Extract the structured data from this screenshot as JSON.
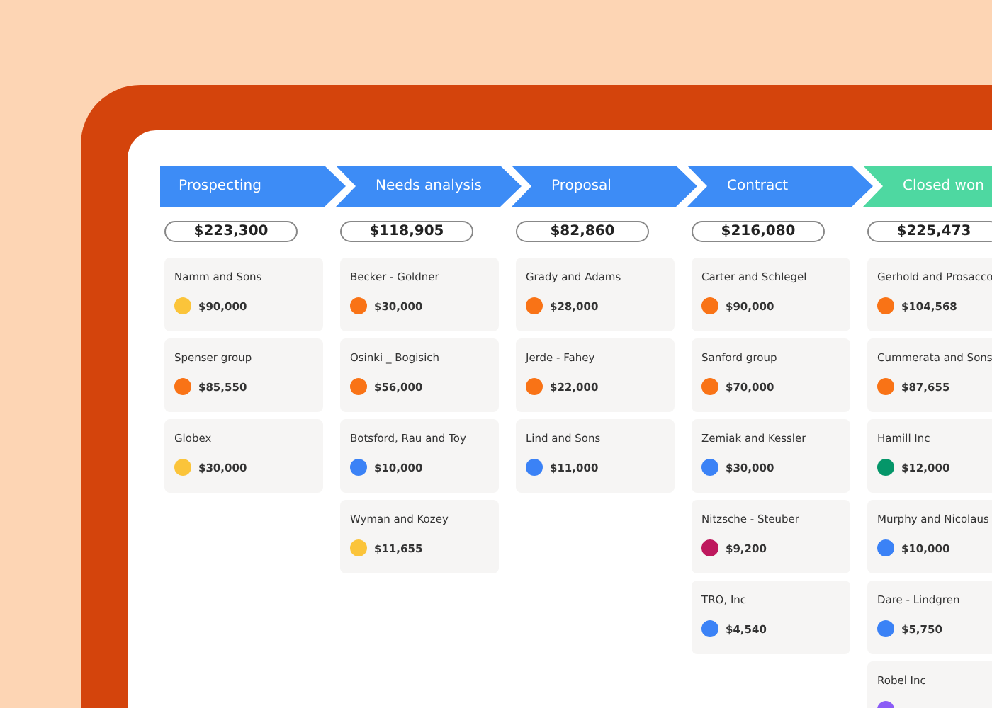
{
  "stages": [
    {
      "name": "Prospecting",
      "color": "#3d8cf6",
      "total": "$223,300",
      "deals": [
        {
          "company": "Namm and Sons",
          "amount": "$90,000",
          "color": "#fbc43a"
        },
        {
          "company": "Spenser group",
          "amount": "$85,550",
          "color": "#f97316"
        },
        {
          "company": "Globex",
          "amount": "$30,000",
          "color": "#fbc43a"
        }
      ]
    },
    {
      "name": "Needs analysis",
      "color": "#3d8cf6",
      "total": "$118,905",
      "deals": [
        {
          "company": "Becker - Goldner",
          "amount": "$30,000",
          "color": "#f97316"
        },
        {
          "company": "Osinki _ Bogisich",
          "amount": "$56,000",
          "color": "#f97316"
        },
        {
          "company": "Botsford, Rau and Toy",
          "amount": "$10,000",
          "color": "#3b82f6"
        },
        {
          "company": "Wyman and Kozey",
          "amount": "$11,655",
          "color": "#fbc43a"
        }
      ]
    },
    {
      "name": "Proposal",
      "color": "#3d8cf6",
      "total": "$82,860",
      "deals": [
        {
          "company": "Grady and Adams",
          "amount": "$28,000",
          "color": "#f97316"
        },
        {
          "company": "Jerde - Fahey",
          "amount": "$22,000",
          "color": "#f97316"
        },
        {
          "company": "Lind and Sons",
          "amount": "$11,000",
          "color": "#3b82f6"
        }
      ]
    },
    {
      "name": "Contract",
      "color": "#3d8cf6",
      "total": "$216,080",
      "deals": [
        {
          "company": "Carter and Schlegel",
          "amount": "$90,000",
          "color": "#f97316"
        },
        {
          "company": "Sanford group",
          "amount": "$70,000",
          "color": "#f97316"
        },
        {
          "company": "Zemiak and Kessler",
          "amount": "$30,000",
          "color": "#3b82f6"
        },
        {
          "company": "Nitzsche - Steuber",
          "amount": "$9,200",
          "color": "#be185d"
        },
        {
          "company": "TRO, Inc",
          "amount": "$4,540",
          "color": "#3b82f6"
        }
      ]
    },
    {
      "name": "Closed won",
      "color": "#4ed8a1",
      "total": "$225,473",
      "deals": [
        {
          "company": "Gerhold and Prosacco",
          "amount": "$104,568",
          "color": "#f97316"
        },
        {
          "company": "Cummerata and Sons",
          "amount": "$87,655",
          "color": "#f97316"
        },
        {
          "company": "Hamill Inc",
          "amount": "$12,000",
          "color": "#059669"
        },
        {
          "company": "Murphy and Nicolaus",
          "amount": "$10,000",
          "color": "#3b82f6"
        },
        {
          "company": "Dare - Lindgren",
          "amount": "$5,750",
          "color": "#3b82f6"
        },
        {
          "company": "Robel Inc",
          "color": "#8b5cf6"
        }
      ]
    }
  ]
}
